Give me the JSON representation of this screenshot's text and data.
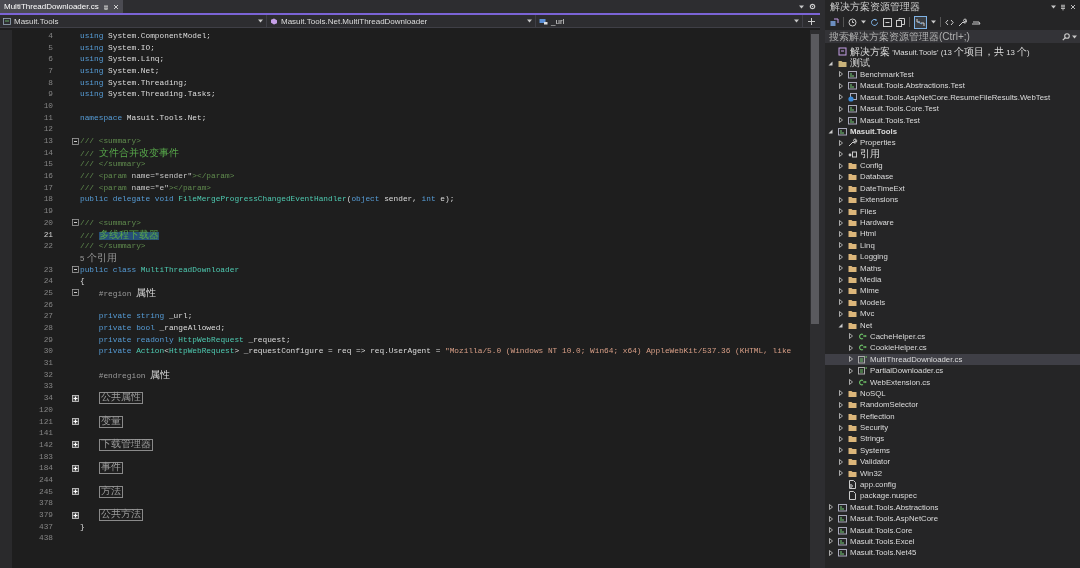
{
  "editor_tabs": [
    {
      "label": "MultiThreadDownloader.cs",
      "selected": true
    }
  ],
  "navigation_bar": {
    "project": "Masuit.Tools",
    "type": "Masuit.Tools.Net.MultiThreadDownloader",
    "member": "_url"
  },
  "editor": {
    "lines": [
      {
        "number": "4",
        "current": false,
        "tokens": [
          {
            "kind": "keyword",
            "text": "using"
          },
          {
            "kind": "plain",
            "text": " System.ComponentModel;"
          }
        ]
      },
      {
        "number": "5",
        "current": false,
        "tokens": [
          {
            "kind": "keyword",
            "text": "using"
          },
          {
            "kind": "plain",
            "text": " System.IO;"
          }
        ]
      },
      {
        "number": "6",
        "current": false,
        "tokens": [
          {
            "kind": "keyword",
            "text": "using"
          },
          {
            "kind": "plain",
            "text": " System.Linq;"
          }
        ]
      },
      {
        "number": "7",
        "current": false,
        "tokens": [
          {
            "kind": "keyword",
            "text": "using"
          },
          {
            "kind": "plain",
            "text": " System.Net;"
          }
        ]
      },
      {
        "number": "8",
        "current": false,
        "tokens": [
          {
            "kind": "keyword",
            "text": "using"
          },
          {
            "kind": "plain",
            "text": " System.Threading;"
          }
        ]
      },
      {
        "number": "9",
        "current": false,
        "tokens": [
          {
            "kind": "keyword",
            "text": "using"
          },
          {
            "kind": "plain",
            "text": " System.Threading.Tasks;"
          }
        ]
      },
      {
        "number": "10",
        "current": false
      },
      {
        "number": "11",
        "current": false,
        "tokens": [
          {
            "kind": "keyword",
            "text": "namespace"
          },
          {
            "kind": "plain",
            "text": " Masuit.Tools.Net;"
          }
        ]
      },
      {
        "number": "12",
        "current": false
      },
      {
        "number": "13",
        "current": false,
        "collapsed": false,
        "tokens": [
          {
            "kind": "doc",
            "text": "/// <summary>"
          }
        ]
      },
      {
        "number": "14",
        "current": false,
        "tokens": [
          {
            "kind": "doc",
            "text": "/// "
          },
          {
            "kind": "doc-text",
            "text": "文件合并改变事件"
          }
        ]
      },
      {
        "number": "15",
        "current": false,
        "tokens": [
          {
            "kind": "doc",
            "text": "/// </summary>"
          }
        ]
      },
      {
        "number": "16",
        "current": false,
        "tokens": [
          {
            "kind": "doc",
            "text": "/// <param "
          },
          {
            "kind": "doc-attr",
            "text": "name=\"sender\""
          },
          {
            "kind": "doc",
            "text": "></param>"
          }
        ]
      },
      {
        "number": "17",
        "current": false,
        "tokens": [
          {
            "kind": "doc",
            "text": "/// <param "
          },
          {
            "kind": "doc-attr",
            "text": "name=\"e\""
          },
          {
            "kind": "doc",
            "text": "></param>"
          }
        ]
      },
      {
        "number": "18",
        "current": false,
        "tokens": [
          {
            "kind": "keyword",
            "text": "public delegate void "
          },
          {
            "kind": "type",
            "text": "FileMergeProgressChangedEventHandler"
          },
          {
            "kind": "plain",
            "text": "("
          },
          {
            "kind": "keyword",
            "text": "object"
          },
          {
            "kind": "plain",
            "text": " sender, "
          },
          {
            "kind": "keyword",
            "text": "int"
          },
          {
            "kind": "plain",
            "text": " e);"
          }
        ]
      },
      {
        "number": "19",
        "current": false
      },
      {
        "number": "20",
        "current": false,
        "collapsed": false,
        "tokens": [
          {
            "kind": "doc",
            "text": "/// <summary>"
          }
        ]
      },
      {
        "number": "21",
        "current": true,
        "tokens": [
          {
            "kind": "doc",
            "text": "/// "
          },
          {
            "kind": "selected",
            "text": "多线程下载器"
          }
        ]
      },
      {
        "number": "22",
        "current": false,
        "tokens": [
          {
            "kind": "doc",
            "text": "/// </summary>"
          }
        ]
      },
      {
        "lens": "5 个引用"
      },
      {
        "number": "23",
        "current": false,
        "collapsed": false,
        "tokens": [
          {
            "kind": "keyword",
            "text": "public class "
          },
          {
            "kind": "type",
            "text": "MultiThreadDownloader"
          }
        ]
      },
      {
        "number": "24",
        "current": false,
        "tokens": [
          {
            "kind": "plain",
            "text": "{"
          }
        ]
      },
      {
        "number": "25",
        "current": false,
        "collapsed": false,
        "tokens": [
          {
            "kind": "preproc",
            "text": "    #region "
          },
          {
            "kind": "plain",
            "text": "属性"
          }
        ]
      },
      {
        "number": "26",
        "current": false
      },
      {
        "number": "27",
        "current": false,
        "tokens": [
          {
            "kind": "keyword",
            "text": "    private string"
          },
          {
            "kind": "plain",
            "text": " _url;"
          }
        ]
      },
      {
        "number": "28",
        "current": false,
        "tokens": [
          {
            "kind": "keyword",
            "text": "    private bool"
          },
          {
            "kind": "plain",
            "text": " _rangeAllowed;"
          }
        ]
      },
      {
        "number": "29",
        "current": false,
        "tokens": [
          {
            "kind": "keyword",
            "text": "    private readonly "
          },
          {
            "kind": "type",
            "text": "HttpWebRequest"
          },
          {
            "kind": "plain",
            "text": " _request;"
          }
        ]
      },
      {
        "number": "30",
        "current": false,
        "tokens": [
          {
            "kind": "keyword",
            "text": "    private "
          },
          {
            "kind": "type",
            "text": "Action"
          },
          {
            "kind": "plain",
            "text": "<"
          },
          {
            "kind": "type",
            "text": "HttpWebRequest"
          },
          {
            "kind": "plain",
            "text": "> _requestConfigure = req => req.UserAgent = "
          },
          {
            "kind": "string",
            "text": "\"Mozilla/5.0 (Windows NT 10.0; Win64; x64) AppleWebKit/537.36 (KHTML, like"
          }
        ]
      },
      {
        "number": "31",
        "current": false
      },
      {
        "number": "32",
        "current": false,
        "tokens": [
          {
            "kind": "preproc",
            "text": "    #endregion "
          },
          {
            "kind": "plain",
            "text": "属性"
          }
        ]
      },
      {
        "number": "33",
        "current": false
      },
      {
        "number": "34",
        "current": false,
        "collapsed": true,
        "tokens": [
          {
            "kind": "collapsed",
            "text": "公共属性"
          }
        ]
      },
      {
        "number": "120",
        "current": false
      },
      {
        "number": "121",
        "current": false,
        "collapsed": true,
        "tokens": [
          {
            "kind": "collapsed",
            "text": "变量"
          }
        ]
      },
      {
        "number": "141",
        "current": false
      },
      {
        "number": "142",
        "current": false,
        "collapsed": true,
        "tokens": [
          {
            "kind": "collapsed",
            "text": "下载管理器"
          }
        ]
      },
      {
        "number": "183",
        "current": false
      },
      {
        "number": "184",
        "current": false,
        "collapsed": true,
        "tokens": [
          {
            "kind": "collapsed",
            "text": "事件"
          }
        ]
      },
      {
        "number": "244",
        "current": false
      },
      {
        "number": "245",
        "current": false,
        "collapsed": true,
        "tokens": [
          {
            "kind": "collapsed",
            "text": "方法"
          }
        ]
      },
      {
        "number": "378",
        "current": false
      },
      {
        "number": "379",
        "current": false,
        "collapsed": true,
        "tokens": [
          {
            "kind": "collapsed",
            "text": "公共方法"
          }
        ]
      },
      {
        "number": "437",
        "current": false,
        "tokens": [
          {
            "kind": "plain",
            "text": "}"
          }
        ]
      },
      {
        "number": "438",
        "current": false
      }
    ]
  },
  "solution_explorer": {
    "title": "解决方案资源管理器",
    "search": {
      "placeholder": "搜索解决方案资源管理器(Ctrl+;)"
    },
    "solution": "解决方案 'Masuit.Tools' (13 个项目，共 13 个)",
    "items": [
      {
        "label": "测试",
        "kind": "solution-folder",
        "expanded": true,
        "selected": false,
        "children": [
          {
            "label": "BenchmarkTest",
            "kind": "project",
            "expanded": false,
            "selected": false
          },
          {
            "label": "Masuit.Tools.Abstractions.Test",
            "kind": "project",
            "expanded": false,
            "selected": false
          },
          {
            "label": "Masuit.Tools.AspNetCore.ResumeFileResults.WebTest",
            "kind": "web-project",
            "expanded": false,
            "selected": false
          },
          {
            "label": "Masuit.Tools.Core.Test",
            "kind": "project",
            "expanded": false,
            "selected": false
          },
          {
            "label": "Masuit.Tools.Test",
            "kind": "project",
            "expanded": false,
            "selected": false
          }
        ]
      },
      {
        "label": "Masuit.Tools",
        "kind": "project",
        "expanded": true,
        "selected": false,
        "startup": true,
        "children": [
          {
            "label": "Properties",
            "kind": "properties",
            "expanded": false,
            "selected": false
          },
          {
            "label": "引用",
            "kind": "references",
            "expanded": false,
            "selected": false
          },
          {
            "label": "Config",
            "kind": "folder",
            "expanded": false,
            "selected": false
          },
          {
            "label": "Database",
            "kind": "folder",
            "expanded": false,
            "selected": false
          },
          {
            "label": "DateTimeExt",
            "kind": "folder",
            "expanded": false,
            "selected": false
          },
          {
            "label": "Extensions",
            "kind": "folder",
            "expanded": false,
            "selected": false
          },
          {
            "label": "Files",
            "kind": "folder",
            "expanded": false,
            "selected": false
          },
          {
            "label": "Hardware",
            "kind": "folder",
            "expanded": false,
            "selected": false
          },
          {
            "label": "Html",
            "kind": "folder",
            "expanded": false,
            "selected": false
          },
          {
            "label": "Linq",
            "kind": "folder",
            "expanded": false,
            "selected": false
          },
          {
            "label": "Logging",
            "kind": "folder",
            "expanded": false,
            "selected": false
          },
          {
            "label": "Maths",
            "kind": "folder",
            "expanded": false,
            "selected": false
          },
          {
            "label": "Media",
            "kind": "folder",
            "expanded": false,
            "selected": false
          },
          {
            "label": "Mime",
            "kind": "folder",
            "expanded": false,
            "selected": false
          },
          {
            "label": "Models",
            "kind": "folder",
            "expanded": false,
            "selected": false
          },
          {
            "label": "Mvc",
            "kind": "folder",
            "expanded": false,
            "selected": false
          },
          {
            "label": "Net",
            "kind": "folder",
            "expanded": true,
            "selected": false,
            "children": [
              {
                "label": "CacheHelper.cs",
                "kind": "cs-file",
                "expanded": false,
                "selected": false
              },
              {
                "label": "CookieHelper.cs",
                "kind": "cs-file",
                "expanded": false,
                "selected": false
              },
              {
                "label": "MultiThreadDownloader.cs",
                "kind": "cs-class-file",
                "expanded": false,
                "selected": true
              },
              {
                "label": "PartialDownloader.cs",
                "kind": "cs-class-file",
                "expanded": false,
                "selected": false
              },
              {
                "label": "WebExtension.cs",
                "kind": "cs-file",
                "expanded": false,
                "selected": false
              }
            ]
          },
          {
            "label": "NoSQL",
            "kind": "folder",
            "expanded": false,
            "selected": false
          },
          {
            "label": "RandomSelector",
            "kind": "folder",
            "expanded": false,
            "selected": false
          },
          {
            "label": "Reflection",
            "kind": "folder",
            "expanded": false,
            "selected": false
          },
          {
            "label": "Security",
            "kind": "folder",
            "expanded": false,
            "selected": false
          },
          {
            "label": "Strings",
            "kind": "folder",
            "expanded": false,
            "selected": false
          },
          {
            "label": "Systems",
            "kind": "folder",
            "expanded": false,
            "selected": false
          },
          {
            "label": "Validator",
            "kind": "folder",
            "expanded": false,
            "selected": false
          },
          {
            "label": "Win32",
            "kind": "folder",
            "expanded": false,
            "selected": false
          },
          {
            "label": "app.config",
            "kind": "config",
            "selected": false
          },
          {
            "label": "package.nuspec",
            "kind": "file",
            "selected": false
          }
        ]
      },
      {
        "label": "Masuit.Tools.Abstractions",
        "kind": "project",
        "expanded": false,
        "selected": false,
        "startup": false
      },
      {
        "label": "Masuit.Tools.AspNetCore",
        "kind": "project",
        "expanded": false,
        "selected": false,
        "startup": false
      },
      {
        "label": "Masuit.Tools.Core",
        "kind": "project",
        "expanded": false,
        "selected": false,
        "startup": false
      },
      {
        "label": "Masuit.Tools.Excel",
        "kind": "project",
        "expanded": false,
        "selected": false,
        "startup": false
      },
      {
        "label": "Masuit.Tools.Net45",
        "kind": "project",
        "expanded": false,
        "selected": false,
        "startup": false
      }
    ]
  }
}
